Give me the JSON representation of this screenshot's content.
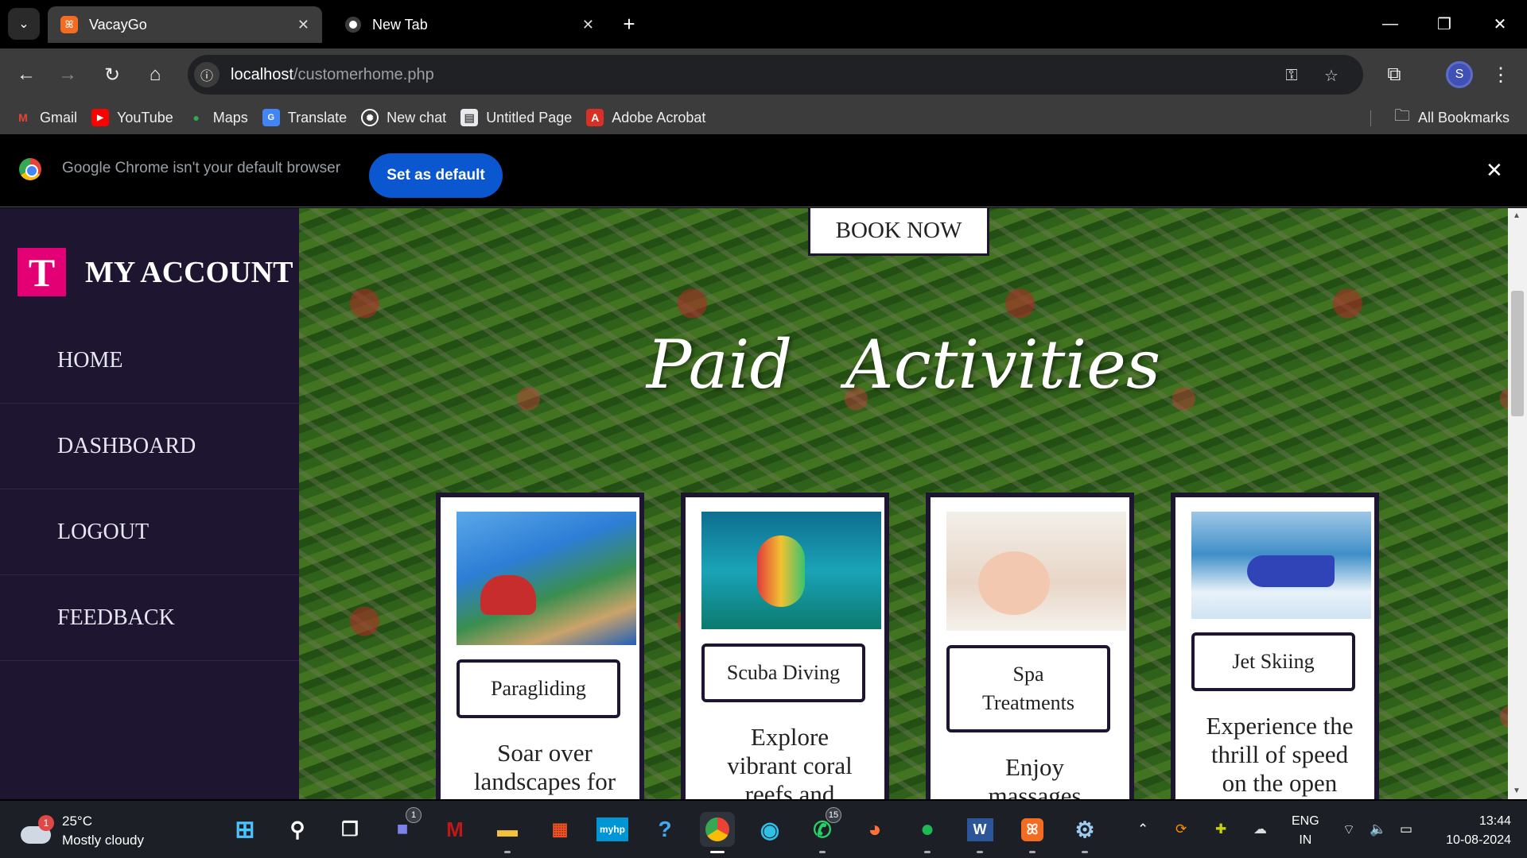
{
  "browser": {
    "tabs": [
      {
        "title": "VacayGo",
        "active": true
      },
      {
        "title": "New Tab",
        "active": false
      }
    ],
    "url_host": "localhost",
    "url_path": "/customerhome.php",
    "bookmarks": [
      "Gmail",
      "YouTube",
      "Maps",
      "Translate",
      "New chat",
      "Untitled Page",
      "Adobe Acrobat"
    ],
    "all_bookmarks": "All Bookmarks",
    "profile_initial": "S",
    "infobar": {
      "message": "Google Chrome isn't your default browser",
      "button": "Set as default"
    }
  },
  "sidebar": {
    "logo_letter": "T",
    "title": "MY ACCOUNT",
    "items": [
      "HOME",
      "DASHBOARD",
      "LOGOUT",
      "FEEDBACK"
    ]
  },
  "main": {
    "book_now": "BOOK NOW",
    "section_title_1": "Paid",
    "section_title_2": "Activities",
    "cards": [
      {
        "label": "Paragliding",
        "desc_1": "Soar over",
        "desc_2": "landscapes for",
        "image": "paragliding-photo"
      },
      {
        "label": "Scuba Diving",
        "desc_1": "Explore",
        "desc_2": "vibrant coral",
        "desc_3": "reefs and",
        "image": "scuba-photo"
      },
      {
        "label_1": "Spa",
        "label_2": "Treatments",
        "desc_1": "Enjoy",
        "desc_2": "massages",
        "image": "spa-photo"
      },
      {
        "label": "Jet Skiing",
        "desc_1": "Experience the",
        "desc_2": "thrill of speed",
        "desc_3": "on the open",
        "image": "jetski-photo"
      }
    ]
  },
  "taskbar": {
    "weather_temp": "25°C",
    "weather_desc": "Mostly cloudy",
    "weather_badge": "1",
    "teams_badge": "1",
    "whatsapp_badge": "15",
    "lang_1": "ENG",
    "lang_2": "IN",
    "time": "13:44",
    "date": "10-08-2024"
  },
  "colors": {
    "sidebar_bg": "#1e1630",
    "brand_magenta": "#e20074",
    "set_default_blue": "#0b57d0"
  }
}
